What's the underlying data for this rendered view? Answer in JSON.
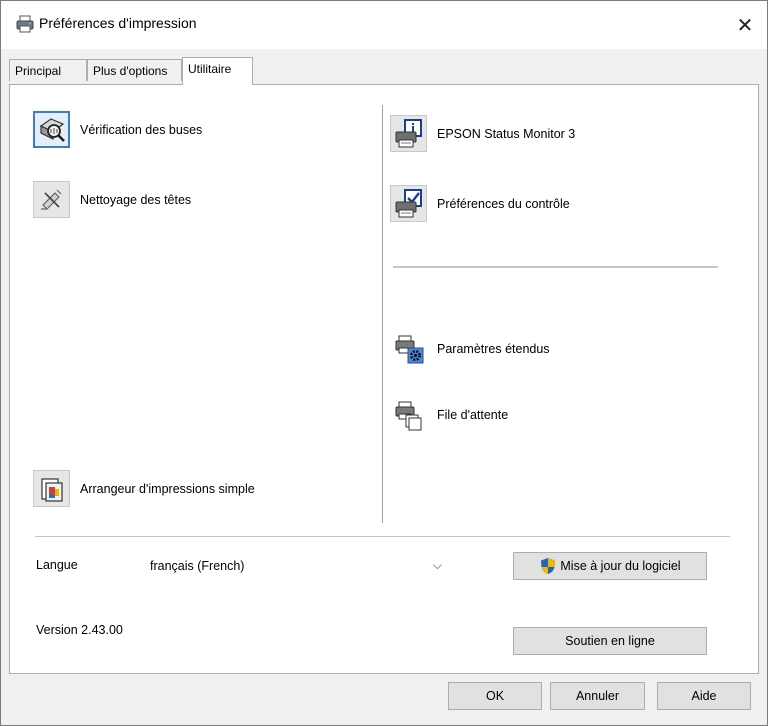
{
  "window": {
    "title": "Préférences d'impression",
    "close_glyph": "✕",
    "title_icon": "printer-icon"
  },
  "tabs": [
    {
      "label": "Principal",
      "active": false
    },
    {
      "label": "Plus d'options",
      "active": false
    },
    {
      "label": "Utilitaire",
      "active": true
    }
  ],
  "tools_left": [
    {
      "label": "Vérification des buses",
      "icon": "nozzle-check-icon"
    },
    {
      "label": "Nettoyage des têtes",
      "icon": "head-cleaning-icon"
    },
    {
      "label": "Arrangeur d'impressions simple",
      "icon": "print-arranger-icon"
    }
  ],
  "tools_right": [
    {
      "label": "EPSON Status Monitor 3",
      "icon": "status-monitor-icon"
    },
    {
      "label": "Préférences du contrôle",
      "icon": "monitoring-preferences-icon"
    },
    {
      "label": "Paramètres étendus",
      "icon": "extended-settings-icon"
    },
    {
      "label": "File d'attente",
      "icon": "print-queue-icon"
    }
  ],
  "language": {
    "label": "Langue",
    "selected": "français (French)",
    "chevron": "⌵"
  },
  "buttons": {
    "update": "Mise à jour du logiciel",
    "support": "Soutien en ligne",
    "ok": "OK",
    "cancel": "Annuler",
    "help": "Aide"
  },
  "version": "Version 2.43.00",
  "colors": {
    "selected_border": "#3c7fc0",
    "shield_blue": "#2563b8",
    "shield_yellow": "#f2b700"
  }
}
